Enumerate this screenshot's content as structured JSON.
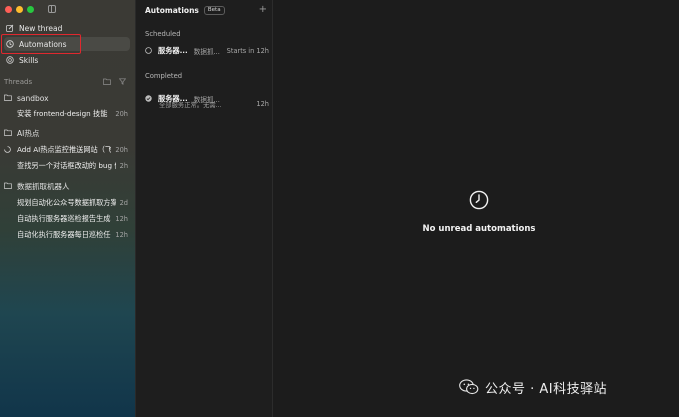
{
  "sidebar": {
    "nav": {
      "new_thread": "New thread",
      "automations": "Automations",
      "skills": "Skills"
    },
    "threads_header": "Threads",
    "groups": [
      {
        "name": "sandbox",
        "threads": [
          {
            "title": "安装 frontend-design 技能",
            "time": "20h"
          }
        ]
      },
      {
        "name": "AI热点",
        "threads": [
          {
            "title": "Add AI热点监控推送网站（飞书）",
            "time": "20h"
          },
          {
            "title": "查找另一个对话框改动的 bug 修复",
            "time": "2h"
          }
        ]
      },
      {
        "name": "数据抓取机器人",
        "threads": [
          {
            "title": "规划自动化公众号数据抓取方案",
            "time": "2d"
          },
          {
            "title": "自动执行服务器巡检报告生成",
            "time": "12h"
          },
          {
            "title": "自动化执行服务器每日巡检任务",
            "time": "12h"
          }
        ]
      }
    ]
  },
  "automations": {
    "title": "Automations",
    "badge": "Beta",
    "add": "+",
    "scheduled_label": "Scheduled",
    "scheduled": {
      "name": "服务器...",
      "sub": "数据抓...",
      "time": "Starts in 12h"
    },
    "completed_label": "Completed",
    "completed": {
      "name": "服务器...",
      "sub": "数据抓...",
      "time": "12h",
      "desc": "全部服务正常。无需..."
    }
  },
  "main": {
    "empty_text": "No unread automations"
  },
  "watermark": {
    "text": "公众号 · AI科技驿站"
  }
}
